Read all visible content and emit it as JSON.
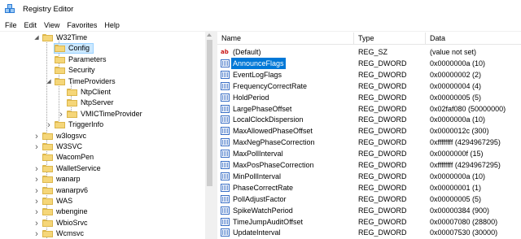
{
  "window": {
    "title": "Registry Editor"
  },
  "menu": [
    "File",
    "Edit",
    "View",
    "Favorites",
    "Help"
  ],
  "tree": [
    {
      "label": "W32Time",
      "level": 1,
      "expanded": true,
      "icon": "folder-icon"
    },
    {
      "label": "Config",
      "level": 2,
      "selected": true,
      "icon": "folder-icon"
    },
    {
      "label": "Parameters",
      "level": 2,
      "icon": "folder-icon"
    },
    {
      "label": "Security",
      "level": 2,
      "icon": "folder-icon"
    },
    {
      "label": "TimeProviders",
      "level": 2,
      "expanded": true,
      "icon": "folder-icon"
    },
    {
      "label": "NtpClient",
      "level": 3,
      "icon": "folder-icon"
    },
    {
      "label": "NtpServer",
      "level": 3,
      "icon": "folder-icon"
    },
    {
      "label": "VMICTimeProvider",
      "level": 3,
      "collapsed": true,
      "icon": "folder-icon"
    },
    {
      "label": "TriggerInfo",
      "level": 2,
      "collapsed": true,
      "icon": "folder-icon"
    },
    {
      "label": "w3logsvc",
      "level": 1,
      "collapsed": true,
      "icon": "folder-icon"
    },
    {
      "label": "W3SVC",
      "level": 1,
      "collapsed": true,
      "icon": "folder-icon"
    },
    {
      "label": "WacomPen",
      "level": 1,
      "icon": "folder-icon"
    },
    {
      "label": "WalletService",
      "level": 1,
      "collapsed": true,
      "icon": "folder-icon"
    },
    {
      "label": "wanarp",
      "level": 1,
      "collapsed": true,
      "icon": "folder-icon"
    },
    {
      "label": "wanarpv6",
      "level": 1,
      "collapsed": true,
      "icon": "folder-icon"
    },
    {
      "label": "WAS",
      "level": 1,
      "collapsed": true,
      "icon": "folder-icon"
    },
    {
      "label": "wbengine",
      "level": 1,
      "collapsed": true,
      "icon": "folder-icon"
    },
    {
      "label": "WbioSrvc",
      "level": 1,
      "collapsed": true,
      "icon": "folder-icon"
    },
    {
      "label": "Wcmsvc",
      "level": 1,
      "collapsed": true,
      "icon": "folder-icon"
    }
  ],
  "columns": {
    "name": "Name",
    "type": "Type",
    "data": "Data"
  },
  "values": [
    {
      "name": "(Default)",
      "type": "REG_SZ",
      "data": "(value not set)",
      "icon": "string-value-icon"
    },
    {
      "name": "AnnounceFlags",
      "type": "REG_DWORD",
      "data": "0x0000000a (10)",
      "icon": "dword-value-icon",
      "selected": true
    },
    {
      "name": "EventLogFlags",
      "type": "REG_DWORD",
      "data": "0x00000002 (2)",
      "icon": "dword-value-icon"
    },
    {
      "name": "FrequencyCorrectRate",
      "type": "REG_DWORD",
      "data": "0x00000004 (4)",
      "icon": "dword-value-icon"
    },
    {
      "name": "HoldPeriod",
      "type": "REG_DWORD",
      "data": "0x00000005 (5)",
      "icon": "dword-value-icon"
    },
    {
      "name": "LargePhaseOffset",
      "type": "REG_DWORD",
      "data": "0x02faf080 (50000000)",
      "icon": "dword-value-icon"
    },
    {
      "name": "LocalClockDispersion",
      "type": "REG_DWORD",
      "data": "0x0000000a (10)",
      "icon": "dword-value-icon"
    },
    {
      "name": "MaxAllowedPhaseOffset",
      "type": "REG_DWORD",
      "data": "0x0000012c (300)",
      "icon": "dword-value-icon"
    },
    {
      "name": "MaxNegPhaseCorrection",
      "type": "REG_DWORD",
      "data": "0xffffffff (4294967295)",
      "icon": "dword-value-icon"
    },
    {
      "name": "MaxPollInterval",
      "type": "REG_DWORD",
      "data": "0x0000000f (15)",
      "icon": "dword-value-icon"
    },
    {
      "name": "MaxPosPhaseCorrection",
      "type": "REG_DWORD",
      "data": "0xffffffff (4294967295)",
      "icon": "dword-value-icon"
    },
    {
      "name": "MinPollInterval",
      "type": "REG_DWORD",
      "data": "0x0000000a (10)",
      "icon": "dword-value-icon"
    },
    {
      "name": "PhaseCorrectRate",
      "type": "REG_DWORD",
      "data": "0x00000001 (1)",
      "icon": "dword-value-icon"
    },
    {
      "name": "PollAdjustFactor",
      "type": "REG_DWORD",
      "data": "0x00000005 (5)",
      "icon": "dword-value-icon"
    },
    {
      "name": "SpikeWatchPeriod",
      "type": "REG_DWORD",
      "data": "0x00000384 (900)",
      "icon": "dword-value-icon"
    },
    {
      "name": "TimeJumpAuditOffset",
      "type": "REG_DWORD",
      "data": "0x00007080 (28800)",
      "icon": "dword-value-icon"
    },
    {
      "name": "UpdateInterval",
      "type": "REG_DWORD",
      "data": "0x00007530 (30000)",
      "icon": "dword-value-icon"
    }
  ]
}
